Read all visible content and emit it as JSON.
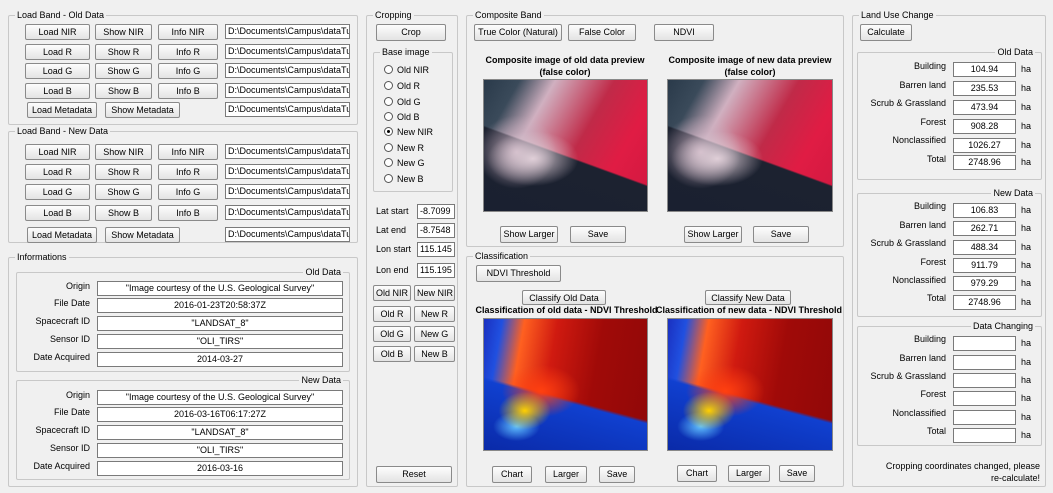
{
  "old_band": {
    "title": "Load Band - Old Data",
    "rows": [
      {
        "load": "Load NIR",
        "show": "Show NIR",
        "info": "Info NIR",
        "path": "D:\\Documents\\Campus\\dataTu"
      },
      {
        "load": "Load R",
        "show": "Show R",
        "info": "Info R",
        "path": "D:\\Documents\\Campus\\dataTu"
      },
      {
        "load": "Load G",
        "show": "Show G",
        "info": "Info G",
        "path": "D:\\Documents\\Campus\\dataTu"
      },
      {
        "load": "Load B",
        "show": "Show B",
        "info": "Info B",
        "path": "D:\\Documents\\Campus\\dataTu"
      }
    ],
    "load_metadata": "Load Metadata",
    "show_metadata": "Show Metadata",
    "metadata_path": "D:\\Documents\\Campus\\dataTu"
  },
  "new_band": {
    "title": "Load Band - New Data",
    "rows": [
      {
        "load": "Load NIR",
        "show": "Show NIR",
        "info": "Info NIR",
        "path": "D:\\Documents\\Campus\\dataTu"
      },
      {
        "load": "Load R",
        "show": "Show R",
        "info": "Info R",
        "path": "D:\\Documents\\Campus\\dataTu"
      },
      {
        "load": "Load G",
        "show": "Show G",
        "info": "Info G",
        "path": "D:\\Documents\\Campus\\dataTu"
      },
      {
        "load": "Load B",
        "show": "Show B",
        "info": "Info B",
        "path": "D:\\Documents\\Campus\\dataTu"
      }
    ],
    "load_metadata": "Load Metadata",
    "show_metadata": "Show Metadata",
    "metadata_path": "D:\\Documents\\Campus\\dataTu"
  },
  "informations": {
    "title": "Informations",
    "labels": {
      "origin": "Origin",
      "file_date": "File Date",
      "spacecraft": "Spacecraft ID",
      "sensor": "Sensor ID",
      "date_acquired": "Date Acquired"
    },
    "old": {
      "title": "Old Data",
      "origin": "\"Image courtesy of the U.S. Geological Survey\"",
      "file_date": "2016-01-23T20:58:37Z",
      "spacecraft": "\"LANDSAT_8\"",
      "sensor": "\"OLI_TIRS\"",
      "date_acquired": "2014-03-27"
    },
    "new": {
      "title": "New Data",
      "origin": "\"Image courtesy of the U.S. Geological Survey\"",
      "file_date": "2016-03-16T06:17:27Z",
      "spacecraft": "\"LANDSAT_8\"",
      "sensor": "\"OLI_TIRS\"",
      "date_acquired": "2016-03-16"
    }
  },
  "cropping": {
    "title": "Cropping",
    "crop": "Crop",
    "base_title": "Base image",
    "options": [
      "Old NIR",
      "Old R",
      "Old G",
      "Old B",
      "New NIR",
      "New R",
      "New G",
      "New B"
    ],
    "selected": "New NIR",
    "lat_start_label": "Lat start",
    "lat_start": "-8.7099",
    "lat_end_label": "Lat end",
    "lat_end": "-8.7548",
    "lon_start_label": "Lon start",
    "lon_start": "115.145",
    "lon_end_label": "Lon end",
    "lon_end": "115.195",
    "pairs": [
      [
        "Old NIR",
        "New NIR"
      ],
      [
        "Old R",
        "New R"
      ],
      [
        "Old G",
        "New G"
      ],
      [
        "Old B",
        "New B"
      ]
    ],
    "reset": "Reset"
  },
  "composite": {
    "title": "Composite Band",
    "true_color": "True Color (Natural)",
    "false_color": "False Color",
    "ndvi": "NDVI",
    "old_title_1": "Composite image of old data preview",
    "old_title_2": "(false color)",
    "new_title_1": "Composite image of new data preview",
    "new_title_2": "(false color)",
    "show_larger": "Show Larger",
    "save": "Save"
  },
  "classification": {
    "title": "Classification",
    "ndvi_threshold": "NDVI Threshold",
    "classify_old": "Classify Old Data",
    "classify_new": "Classify New Data",
    "old_title": "Classification of old data - NDVI Threshold",
    "new_title": "Classification of new data - NDVI Threshold",
    "chart": "Chart",
    "larger": "Larger",
    "save": "Save"
  },
  "land_use": {
    "title": "Land Use Change",
    "calculate": "Calculate",
    "unit": "ha",
    "categories": [
      "Building",
      "Barren land",
      "Scrub & Grassland",
      "Forest",
      "Nonclassified",
      "Total"
    ],
    "old": {
      "title": "Old Data",
      "values": [
        "104.94",
        "235.53",
        "473.94",
        "908.28",
        "1026.27",
        "2748.96"
      ]
    },
    "new": {
      "title": "New Data",
      "values": [
        "106.83",
        "262.71",
        "488.34",
        "911.79",
        "979.29",
        "2748.96"
      ]
    },
    "change": {
      "title": "Data Changing",
      "values": [
        "",
        "",
        "",
        "",
        "",
        ""
      ]
    },
    "status_1": "Cropping coordinates changed, please",
    "status_2": "re-calculate!"
  }
}
